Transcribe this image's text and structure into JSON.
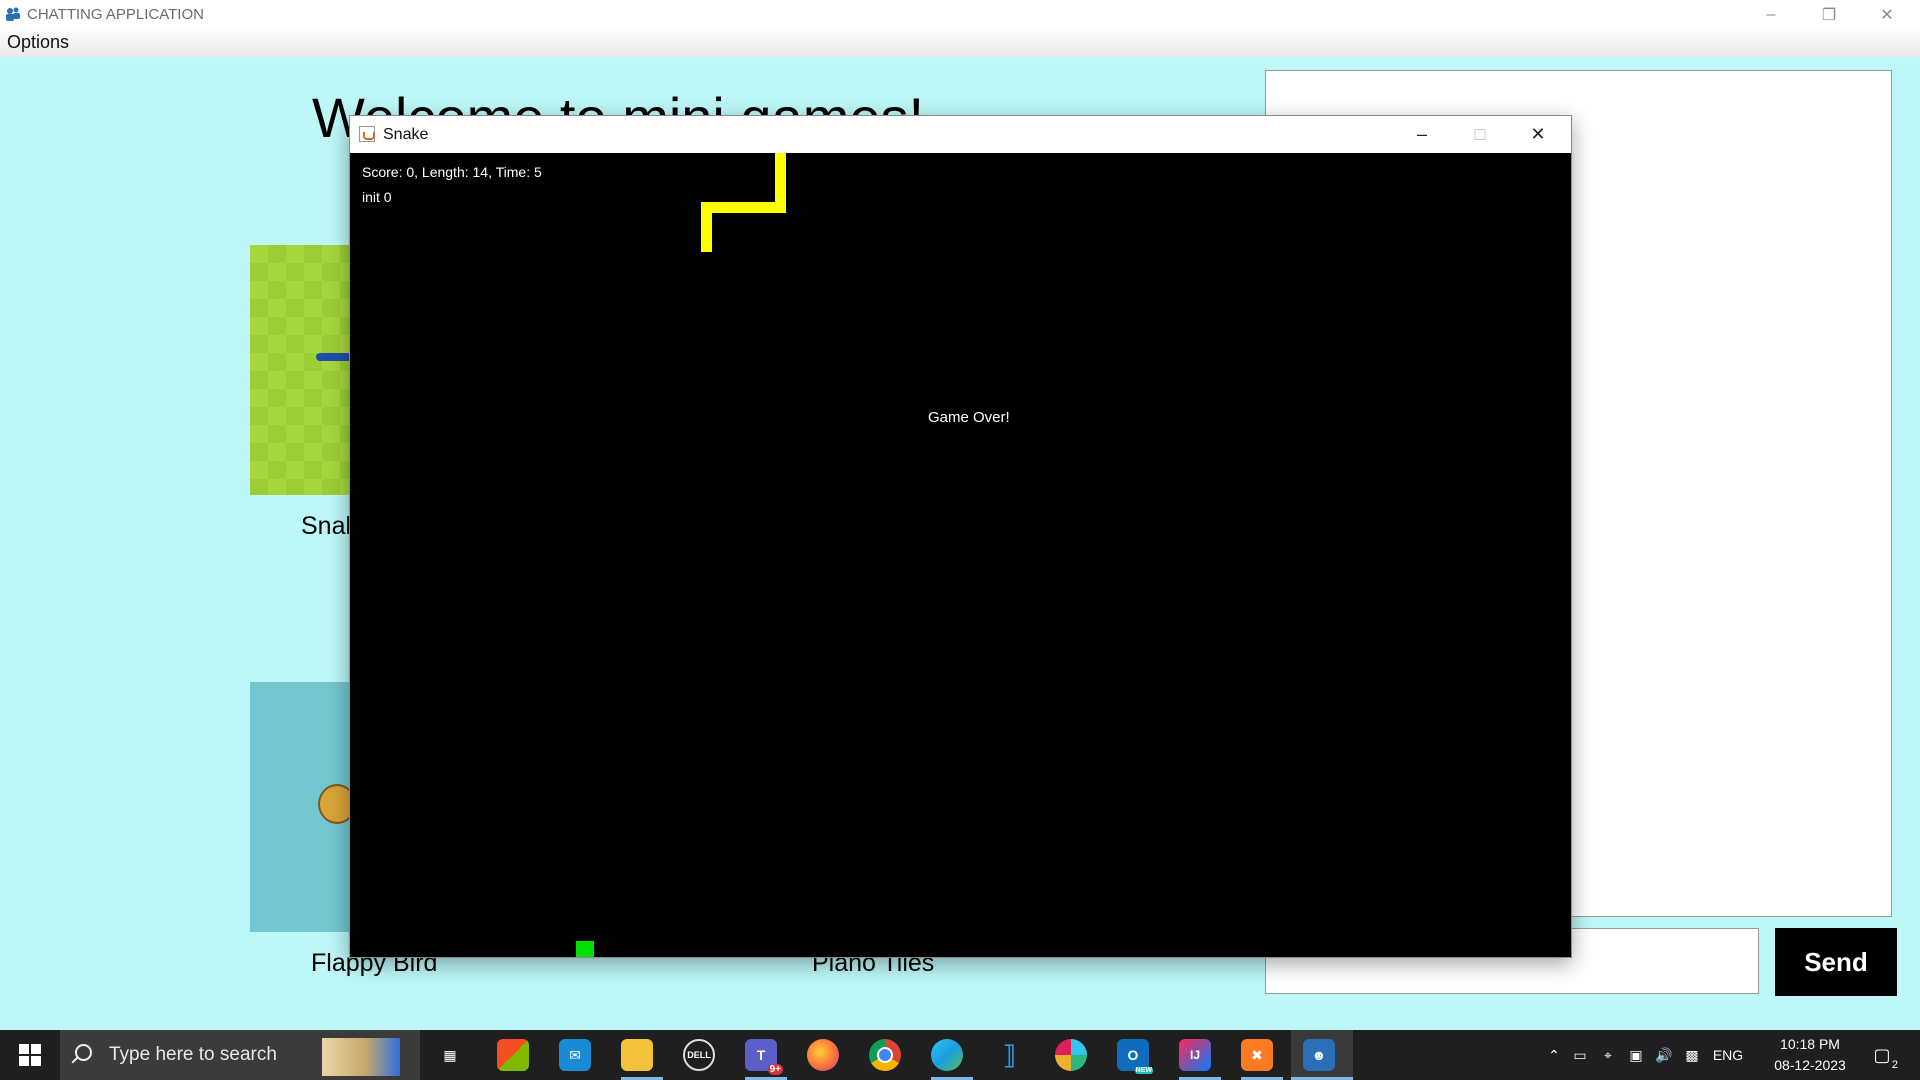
{
  "app": {
    "title": "CHATTING APPLICATION",
    "menu": {
      "options": "Options"
    }
  },
  "main": {
    "welcome_title": "Welcome to mini games!",
    "games": [
      {
        "label": "Snake"
      },
      {
        "label": "Flappy Bird"
      },
      {
        "label": "Piano Tiles"
      }
    ],
    "send_label": "Send",
    "message_input_value": ""
  },
  "snake_window": {
    "title": "Snake",
    "hud_score": "Score: 0, Length: 14, Time: 5",
    "hud_init": "init 0",
    "game_over": "Game Over!",
    "snake_color": "#ffff00",
    "food_color": "#00e000"
  },
  "taskbar": {
    "search_placeholder": "Type here to search",
    "apps": [
      "task-view",
      "microsoft-store",
      "mail",
      "file-explorer",
      "dell",
      "teams",
      "firefox",
      "chrome",
      "edge",
      "vscode",
      "slack",
      "outlook-new",
      "intellij",
      "xampp",
      "chatting-app"
    ],
    "teams_badge": "9+",
    "outlook_badge": "NEW",
    "language": "ENG",
    "time": "10:18 PM",
    "date": "08-12-2023",
    "notification_count": "2"
  }
}
